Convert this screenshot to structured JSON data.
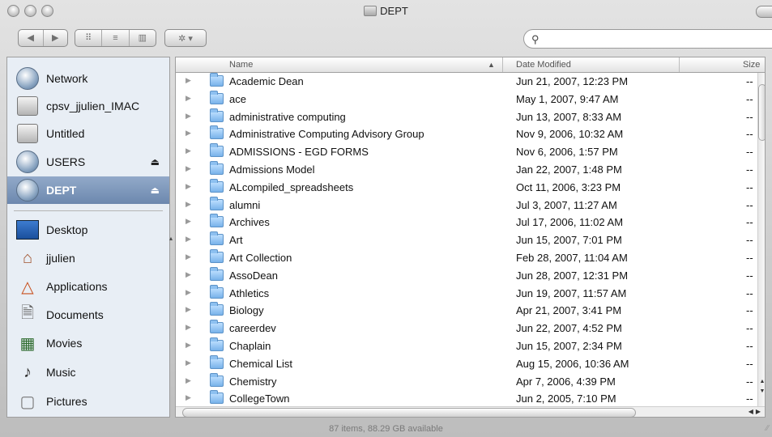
{
  "window": {
    "title": "DEPT"
  },
  "toolbar": {
    "nav_back": "◀",
    "nav_forward": "▶",
    "view_icon": "⠿",
    "view_list": "≡",
    "view_columns": "▥",
    "action": "✲ ▾",
    "search_placeholder": ""
  },
  "sidebar": {
    "devices": [
      {
        "label": "Network",
        "icon": "globe-icon",
        "eject": false
      },
      {
        "label": "cpsv_jjulien_IMAC",
        "icon": "hard-disk-icon",
        "eject": false
      },
      {
        "label": "Untitled",
        "icon": "hard-disk-icon",
        "eject": false
      },
      {
        "label": "USERS",
        "icon": "network-volume-icon",
        "eject": true
      },
      {
        "label": "DEPT",
        "icon": "network-volume-icon",
        "eject": true,
        "selected": true
      }
    ],
    "places": [
      {
        "label": "Desktop",
        "icon": "desktop-icon"
      },
      {
        "label": "jjulien",
        "icon": "home-icon"
      },
      {
        "label": "Applications",
        "icon": "applications-icon"
      },
      {
        "label": "Documents",
        "icon": "documents-icon"
      },
      {
        "label": "Movies",
        "icon": "movies-icon"
      },
      {
        "label": "Music",
        "icon": "music-icon"
      },
      {
        "label": "Pictures",
        "icon": "pictures-icon"
      }
    ],
    "eject_glyph": "⏏"
  },
  "columns": {
    "name": "Name",
    "date": "Date Modified",
    "size": "Size",
    "sort_indicator": "▲"
  },
  "files": [
    {
      "name": "Academic Dean",
      "date": "Jun 21, 2007, 12:23 PM",
      "size": "--"
    },
    {
      "name": "ace",
      "date": "May 1, 2007, 9:47 AM",
      "size": "--"
    },
    {
      "name": "administrative computing",
      "date": "Jun 13, 2007, 8:33 AM",
      "size": "--"
    },
    {
      "name": "Administrative Computing Advisory Group",
      "date": "Nov 9, 2006, 10:32 AM",
      "size": "--"
    },
    {
      "name": "ADMISSIONS - EGD FORMS",
      "date": "Nov 6, 2006, 1:57 PM",
      "size": "--"
    },
    {
      "name": "Admissions Model",
      "date": "Jan 22, 2007, 1:48 PM",
      "size": "--"
    },
    {
      "name": "ALcompiled_spreadsheets",
      "date": "Oct 11, 2006, 3:23 PM",
      "size": "--"
    },
    {
      "name": "alumni",
      "date": "Jul 3, 2007, 11:27 AM",
      "size": "--"
    },
    {
      "name": "Archives",
      "date": "Jul 17, 2006, 11:02 AM",
      "size": "--"
    },
    {
      "name": "Art",
      "date": "Jun 15, 2007, 7:01 PM",
      "size": "--"
    },
    {
      "name": "Art Collection",
      "date": "Feb 28, 2007, 11:04 AM",
      "size": "--"
    },
    {
      "name": "AssoDean",
      "date": "Jun 28, 2007, 12:31 PM",
      "size": "--"
    },
    {
      "name": "Athletics",
      "date": "Jun 19, 2007, 11:57 AM",
      "size": "--"
    },
    {
      "name": "Biology",
      "date": "Apr 21, 2007, 3:41 PM",
      "size": "--"
    },
    {
      "name": "careerdev",
      "date": "Jun 22, 2007, 4:52 PM",
      "size": "--"
    },
    {
      "name": "Chaplain",
      "date": "Jun 15, 2007, 2:34 PM",
      "size": "--"
    },
    {
      "name": "Chemical List",
      "date": "Aug 15, 2006, 10:36 AM",
      "size": "--"
    },
    {
      "name": "Chemistry",
      "date": "Apr 7, 2006, 4:39 PM",
      "size": "--"
    },
    {
      "name": "CollegeTown",
      "date": "Jun 2, 2005, 7:10 PM",
      "size": "--"
    }
  ],
  "status": {
    "text": "87 items, 88.29 GB available"
  }
}
